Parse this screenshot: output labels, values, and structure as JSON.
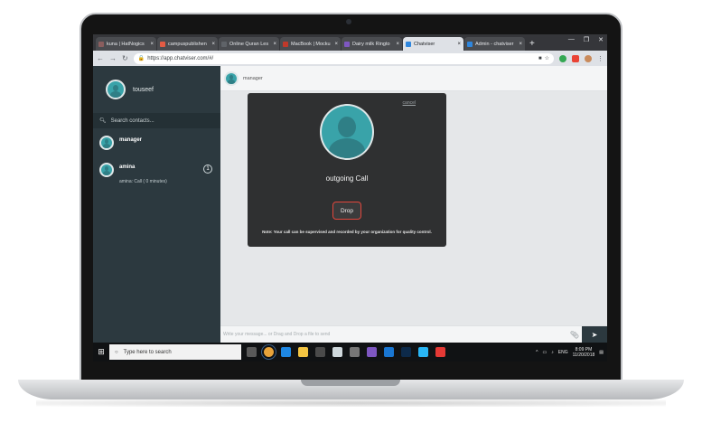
{
  "browser": {
    "tabs": [
      {
        "label": "kuna | HatNogics",
        "color": "#8b5e5e",
        "active": false
      },
      {
        "label": "campuspublishen",
        "color": "#e35b44",
        "active": false
      },
      {
        "label": "Online Quran Les",
        "color": "#5f6368",
        "active": false
      },
      {
        "label": "MacBook | Mocku",
        "color": "#c0392b",
        "active": false
      },
      {
        "label": "Dairy milk Ringto",
        "color": "#7e57c2",
        "active": false
      },
      {
        "label": "Chatviser",
        "color": "#2e86de",
        "active": true
      },
      {
        "label": "Admin - chatviser",
        "color": "#2e86de",
        "active": false
      }
    ],
    "tab_close": "×",
    "new_tab": "+",
    "window_controls": [
      "—",
      "❐",
      "✕"
    ],
    "url": "https://app.chatviser.com/#/"
  },
  "sidebar": {
    "profile_name": "touseef",
    "search_placeholder": "Search contacts...",
    "contacts": [
      {
        "name": "manager",
        "status": "",
        "badge": ""
      },
      {
        "name": "amina",
        "status": "amina: Call ( 0 minutes)",
        "badge": "1"
      }
    ]
  },
  "chat": {
    "header_name": "manager",
    "call": {
      "cancel_label": "cancel",
      "title": "outgoing Call",
      "drop_label": "Drop",
      "note": "Note: Your call can be supervised and recorded by your organization for quality control."
    },
    "composer_placeholder": "Write your message... or Drag and Drop a file to send"
  },
  "taskbar": {
    "search_placeholder": "Type here to search",
    "tray_language": "ENG",
    "time": "8:09 PM",
    "date": "11/20/2018"
  },
  "colors": {
    "sidebar_bg": "#2c393f",
    "accent_teal": "#39a3a9",
    "drop_border": "#e2463c"
  }
}
